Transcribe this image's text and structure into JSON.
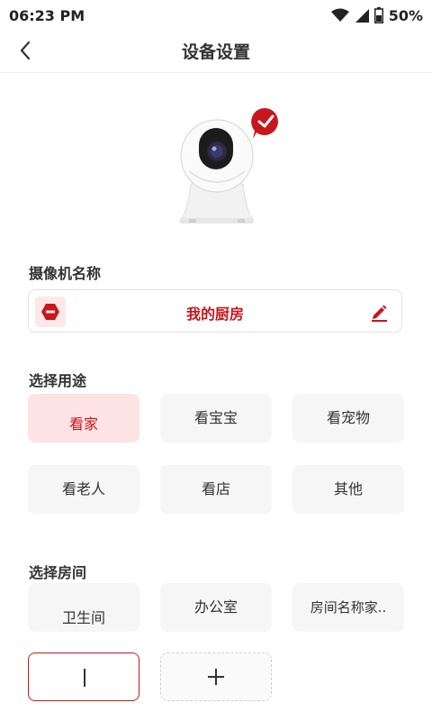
{
  "status": {
    "time": "06:23 PM",
    "battery": "50%"
  },
  "header": {
    "title": "设备设置"
  },
  "camera_name": {
    "label": "摄像机名称",
    "value": "我的厨房"
  },
  "usage": {
    "label": "选择用途",
    "options": [
      "看家",
      "看宝宝",
      "看宠物",
      "看老人",
      "看店",
      "其他"
    ],
    "selected": "看家"
  },
  "room": {
    "label": "选择房间",
    "options": [
      "卫生间",
      "办公室",
      "房间名称家.."
    ],
    "add_symbol": "+"
  },
  "colors": {
    "accent": "#c8161d",
    "selected_bg": "#fde3e3",
    "chip_bg": "#f6f6f6"
  },
  "icons": [
    "back-arrow-icon",
    "wifi-icon",
    "signal-icon",
    "battery-icon",
    "check-badge-icon",
    "camera-brand-icon",
    "edit-pencil-icon",
    "plus-icon"
  ]
}
